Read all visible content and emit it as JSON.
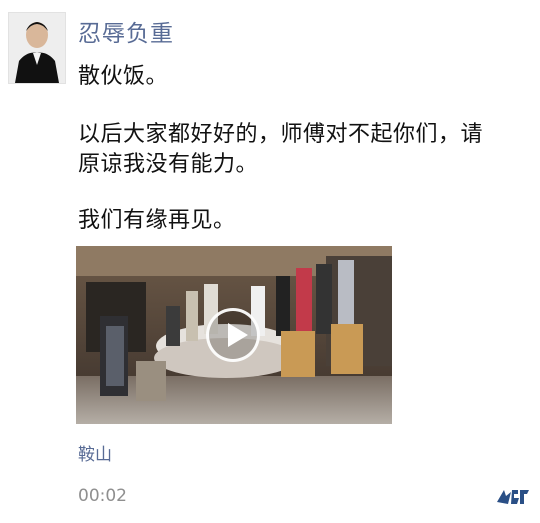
{
  "post": {
    "username": "忍辱负重",
    "lines": [
      "散伙饭。",
      "以后大家都好好的，师傅对不起你们，请",
      "原谅我没有能力。",
      "我们有缘再见。"
    ],
    "location": "鞍山",
    "time": "00:02"
  },
  "icons": {
    "play": "play-icon",
    "watermark": "watermark-logo"
  }
}
